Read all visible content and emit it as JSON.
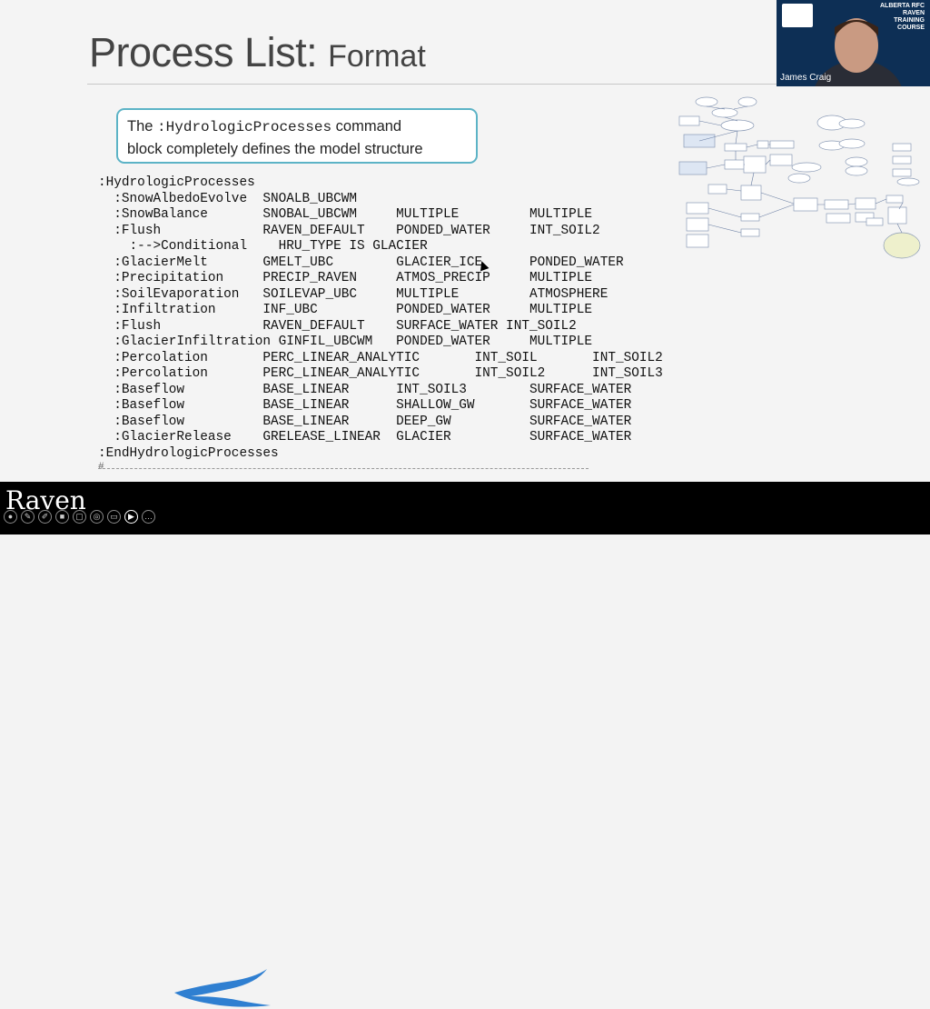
{
  "slide": {
    "title_main": "Process List: ",
    "title_sub": "Format",
    "callout": {
      "pre": "The ",
      "command": ":HydrologicProcesses",
      "post": " command",
      "line2": "block completely defines the model structure"
    },
    "code_lines": [
      ":HydrologicProcesses",
      "  :SnowAlbedoEvolve  SNOALB_UBCWM",
      "  :SnowBalance       SNOBAL_UBCWM     MULTIPLE         MULTIPLE",
      "  :Flush             RAVEN_DEFAULT    PONDED_WATER     INT_SOIL2",
      "    :-->Conditional    HRU_TYPE IS GLACIER",
      "  :GlacierMelt       GMELT_UBC        GLACIER_ICE      PONDED_WATER",
      "  :Precipitation     PRECIP_RAVEN     ATMOS_PRECIP     MULTIPLE",
      "  :SoilEvaporation   SOILEVAP_UBC     MULTIPLE         ATMOSPHERE",
      "  :Infiltration      INF_UBC          PONDED_WATER     MULTIPLE",
      "  :Flush             RAVEN_DEFAULT    SURFACE_WATER INT_SOIL2",
      "  :GlacierInfiltration GINFIL_UBCWM   PONDED_WATER     MULTIPLE",
      "  :Percolation       PERC_LINEAR_ANALYTIC       INT_SOIL       INT_SOIL2",
      "  :Percolation       PERC_LINEAR_ANALYTIC       INT_SOIL2      INT_SOIL3",
      "  :Baseflow          BASE_LINEAR      INT_SOIL3        SURFACE_WATER",
      "  :Baseflow          BASE_LINEAR      SHALLOW_GW       SURFACE_WATER",
      "  :Baseflow          BASE_LINEAR      DEEP_GW          SURFACE_WATER",
      "  :GlacierRelease    GRELEASE_LINEAR  GLACIER          SURFACE_WATER",
      ":EndHydrologicProcesses"
    ],
    "comment_mark": "#"
  },
  "video": {
    "speaker": "James Craig",
    "course_lines": [
      "ALBERTA RFC",
      "RAVEN",
      "TRAINING",
      "COURSE"
    ]
  },
  "bottom_bar": {
    "brand": "Raven"
  },
  "colors": {
    "callout_border": "#5cb3c6",
    "river": "#2f7fd1"
  },
  "toolbar_icons": [
    "mic-icon",
    "edit-icon",
    "pen-icon",
    "camera-icon",
    "crop-icon",
    "record-icon",
    "monitor-icon",
    "camera-active-icon",
    "more-icon"
  ]
}
